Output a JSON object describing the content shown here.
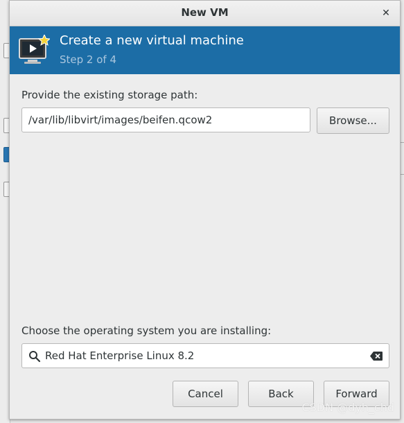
{
  "dialog": {
    "title": "New VM",
    "close_glyph": "✕"
  },
  "banner": {
    "title": "Create a new virtual machine",
    "step": "Step 2 of 4",
    "icon": "virtual-machine-new-icon"
  },
  "storage": {
    "label": "Provide the existing storage path:",
    "path_value": "/var/lib/libvirt/images/beifen.qcow2",
    "browse_label": "Browse..."
  },
  "os": {
    "label": "Choose the operating system you are installing:",
    "search_value": "Red Hat Enterprise Linux 8.2",
    "search_icon": "search-icon",
    "clear_icon": "clear-icon"
  },
  "buttons": {
    "cancel": "Cancel",
    "back": "Back",
    "forward": "Forward"
  },
  "watermark": "CSDN @dyh_chd",
  "colors": {
    "banner_bg": "#1c6da6",
    "banner_step": "#aac6de",
    "dialog_bg": "#ededed"
  }
}
